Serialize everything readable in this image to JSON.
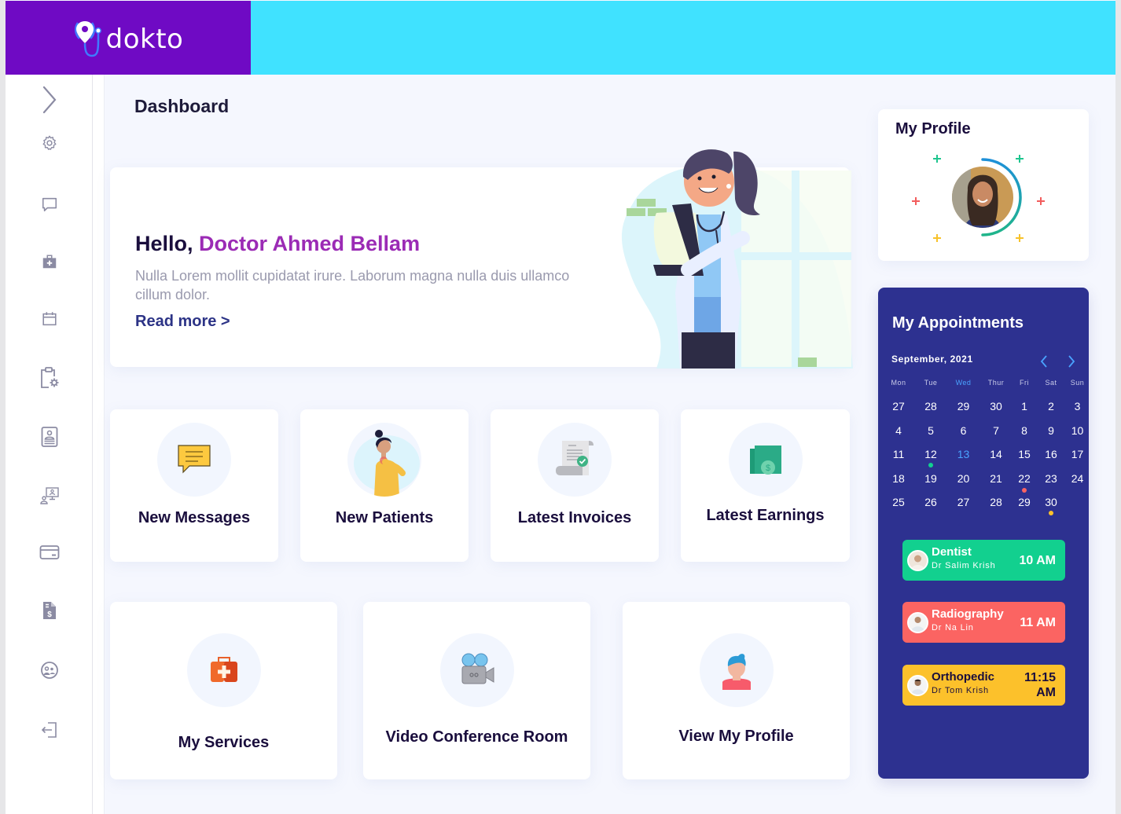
{
  "brand": {
    "name": "dokto"
  },
  "colors": {
    "brand_purple": "#6f0ac4",
    "topbar_cyan": "#40e2ff",
    "accent_magenta": "#9b2bb5",
    "link_navy": "#2c3386",
    "appointments_bg": "#2d3190",
    "dentist_green": "#12d08f",
    "radiography_red": "#fb6462",
    "orthopedic_yellow": "#fcc12b",
    "today_blue": "#4aa3ff"
  },
  "sidebar": {
    "items": [
      {
        "id": "expand",
        "icon": "chevron-right-icon"
      },
      {
        "id": "settings",
        "icon": "gear-icon"
      },
      {
        "id": "messages",
        "icon": "chat-bubble-icon"
      },
      {
        "id": "services",
        "icon": "medical-kit-icon"
      },
      {
        "id": "calendar",
        "icon": "calendar-icon"
      },
      {
        "id": "clipboard-settings",
        "icon": "clipboard-gear-icon"
      },
      {
        "id": "profile-badge",
        "icon": "id-badge-icon"
      },
      {
        "id": "video-conference",
        "icon": "monitor-user-icon"
      },
      {
        "id": "payments",
        "icon": "credit-card-icon"
      },
      {
        "id": "invoices",
        "icon": "invoice-dollar-icon"
      },
      {
        "id": "patients",
        "icon": "users-circle-icon"
      },
      {
        "id": "logout",
        "icon": "logout-icon"
      }
    ]
  },
  "main": {
    "title": "Dashboard",
    "hero": {
      "greeting": "Hello,",
      "name": "Doctor Ahmed Bellam",
      "text": "Nulla Lorem mollit cupidatat irure. Laborum magna nulla duis ullamco cillum dolor.",
      "link": "Read more >"
    },
    "tiles": [
      {
        "label": "New Messages",
        "icon": "message-icon"
      },
      {
        "label": "New Patients",
        "icon": "patient-icon"
      },
      {
        "label": "Latest Invoices",
        "icon": "invoice-icon"
      },
      {
        "label": "Latest Earnings",
        "icon": "money-icon"
      }
    ],
    "big_tiles": [
      {
        "label": "My Services",
        "icon": "first-aid-kit-icon"
      },
      {
        "label": "Video Conference Room",
        "icon": "video-camera-icon"
      },
      {
        "label": "View My Profile",
        "icon": "user-avatar-icon"
      }
    ]
  },
  "profile": {
    "title": "My Profile"
  },
  "appointments": {
    "title": "My Appointments",
    "month": "September, 2021",
    "weekdays": [
      "Mon",
      "Tue",
      "Wed",
      "Thur",
      "Fri",
      "Sat",
      "Sun"
    ],
    "today_weekday_index": 2,
    "weeks": [
      [
        "27",
        "28",
        "29",
        "30",
        "1",
        "2",
        "3"
      ],
      [
        "4",
        "5",
        "6",
        "7",
        "8",
        "9",
        "10"
      ],
      [
        "11",
        "12",
        "13",
        "14",
        "15",
        "16",
        "17"
      ],
      [
        "18",
        "19",
        "20",
        "21",
        "22",
        "23",
        "24"
      ],
      [
        "25",
        "26",
        "27",
        "28",
        "29",
        "30",
        ""
      ]
    ],
    "today": "13",
    "marked_days": [
      {
        "day": "12",
        "color": "#12d08f"
      },
      {
        "day": "29",
        "color": "#fb6462",
        "position": "above"
      },
      {
        "day": "30",
        "color": "#fcc12b"
      }
    ],
    "items": [
      {
        "type": "Dentist",
        "doctor": "Dr Salim Krish",
        "time": "10 AM"
      },
      {
        "type": "Radiography",
        "doctor": "Dr Na Lin",
        "time": "11 AM"
      },
      {
        "type": "Orthopedic",
        "doctor": "Dr Tom Krish",
        "time_line1": "11:15",
        "time_line2": "AM"
      }
    ]
  }
}
